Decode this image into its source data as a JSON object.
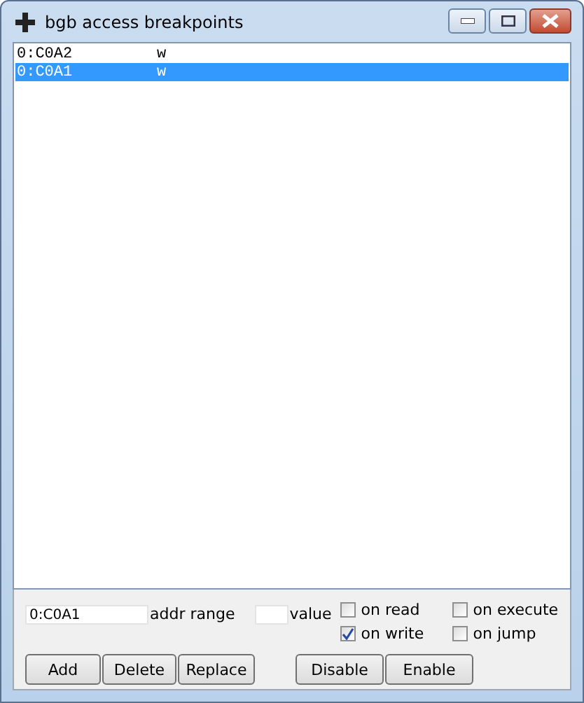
{
  "window": {
    "title": "bgb access breakpoints"
  },
  "breakpoints": [
    {
      "address": "0:C0A2",
      "access": "w",
      "selected": false
    },
    {
      "address": "0:C0A1",
      "access": "w",
      "selected": true
    }
  ],
  "addr_field": {
    "value": "0:C0A1",
    "label": "addr range"
  },
  "value_field": {
    "label": "value"
  },
  "checkboxes": [
    {
      "label": "on read",
      "checked": false
    },
    {
      "label": "on execute",
      "checked": false
    },
    {
      "label": "on write",
      "checked": true
    },
    {
      "label": "on jump",
      "checked": false
    }
  ],
  "buttons_left": [
    "Add",
    "Delete",
    "Replace"
  ],
  "buttons_right": [
    "Disable",
    "Enable"
  ]
}
